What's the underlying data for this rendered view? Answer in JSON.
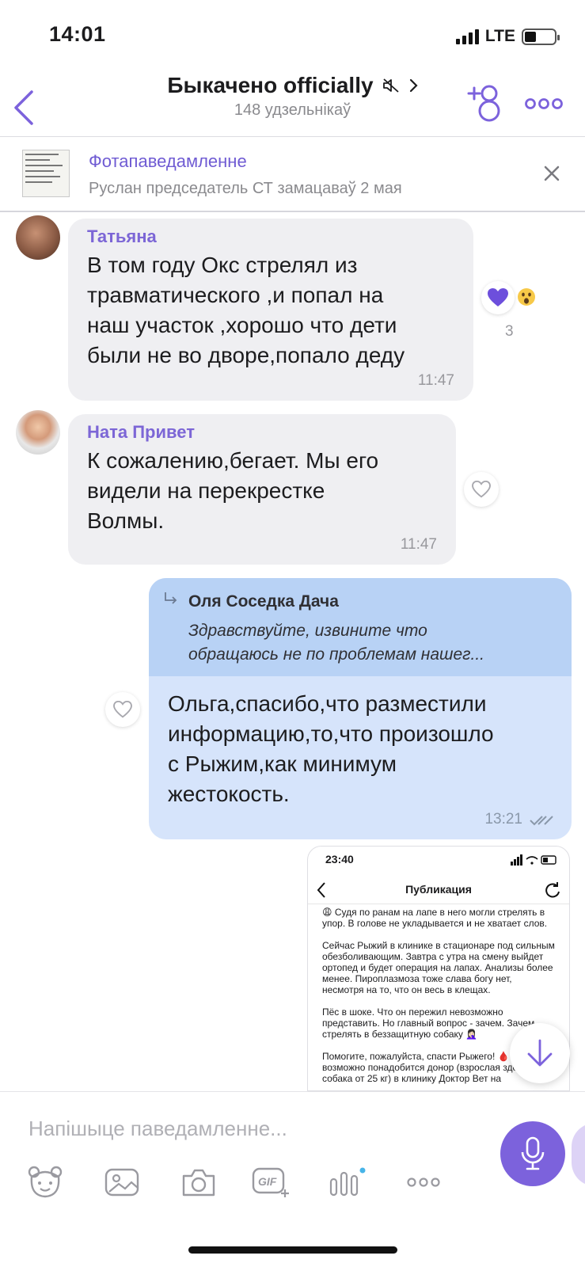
{
  "status_bar": {
    "time": "14:01",
    "network": "LTE"
  },
  "header": {
    "title": "Быкачено officially",
    "subtitle": "148 удзельнікаў",
    "icons": [
      "back-chevron-icon",
      "muted-speaker-icon",
      "chevron-right-icon",
      "add-member-icon",
      "more-dots-icon"
    ]
  },
  "pinned": {
    "title": "Фотапаведамленне",
    "subtitle": "Руслан председатель СТ замацаваў 2 мая"
  },
  "messages": [
    {
      "sender": "Татьяна",
      "text": "В том году Окс стрелял из\nтравматического ,и попал на\nнаш участок ,хорошо что дети\nбыли не во дворе,попало деду",
      "time": "11:47",
      "reaction_count": "3"
    },
    {
      "sender": "Ната Привет",
      "text": "К сожалению,бегает. Мы его\nвидели на перекрестке\nВолмы.",
      "time": "11:47"
    },
    {
      "quote_author": "Оля Соседка Дача",
      "quote_text": "Здравствуйте, извините что\nобращаюсь не по проблемам нашег...",
      "text": "Ольга,спасибо,что разместили\nинформацию,то,что произошло\nс Рыжим,как минимум\nжестокость.",
      "time": "13:21"
    }
  ],
  "image_message": {
    "time": "23:40",
    "title": "Публикация",
    "body": "😩 Судя по ранам на лапе в него могли стрелять в\nупор. В голове не укладывается и не хватает слов.\n\nСейчас Рыжий в клинике в стационаре под сильным\nобезболивающим. Завтра с утра на смену выйдет\nортопед и будет операция на лапах. Анализы более\nменее. Пироплазмоза тоже слава богу нет,\nнесмотря на то, что он весь в клещах.\n\nПёс в шоке. Что он пережил невозможно\nпредставить. Но главный вопрос - зачем. Зачем\nстрелять в беззащитную собаку 🤦🏻‍♀️\n\nПомогите, пожалуйста, спасти Рыжего! 🩸\nвозможно понадобится донор (взрослая здоровая\nсобака от 25 кг) в клинику Доктор Вет на"
  },
  "composer": {
    "placeholder": "Напішыце паведамленне...",
    "toolbar_icons": [
      "sticker-icon",
      "gallery-icon",
      "camera-icon",
      "gif-icon",
      "poll-icon",
      "more-dots-icon"
    ]
  },
  "colors": {
    "accent": "#7c62dc",
    "sender_name": "#7c66d6",
    "incoming_bubble": "#efeff2",
    "outgoing_bubble": "#d6e4fb",
    "quote_bg": "#b8d2f5"
  }
}
